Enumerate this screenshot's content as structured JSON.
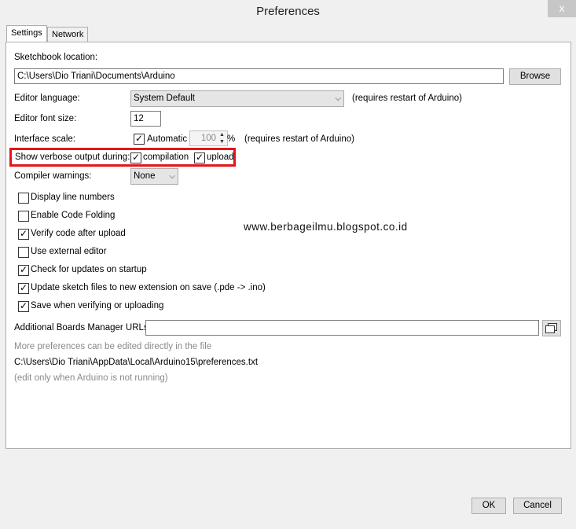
{
  "window": {
    "title": "Preferences",
    "close_glyph": "x"
  },
  "tabs": [
    {
      "label": "Settings"
    },
    {
      "label": "Network"
    }
  ],
  "sketchbook": {
    "label": "Sketchbook location:",
    "value": "C:\\Users\\Dio Triani\\Documents\\Arduino",
    "browse_label": "Browse"
  },
  "language": {
    "label": "Editor language:",
    "value": "System Default",
    "note": "(requires restart of Arduino)"
  },
  "font_size": {
    "label": "Editor font size:",
    "value": "12"
  },
  "scale": {
    "label": "Interface scale:",
    "automatic_label": "Automatic",
    "automatic_checked": true,
    "value": "100",
    "percent": "%",
    "note": "(requires restart of Arduino)"
  },
  "verbose": {
    "label": "Show verbose output during:",
    "compilation_label": "compilation",
    "compilation_checked": true,
    "upload_label": "upload",
    "upload_checked": true
  },
  "warnings": {
    "label": "Compiler warnings:",
    "value": "None"
  },
  "options": [
    {
      "label": "Display line numbers",
      "checked": false
    },
    {
      "label": "Enable Code Folding",
      "checked": false
    },
    {
      "label": "Verify code after upload",
      "checked": true
    },
    {
      "label": "Use external editor",
      "checked": false
    },
    {
      "label": "Check for updates on startup",
      "checked": true
    },
    {
      "label": "Update sketch files to new extension on save (.pde -> .ino)",
      "checked": true
    },
    {
      "label": "Save when verifying or uploading",
      "checked": true
    }
  ],
  "watermark": "www.berbageilmu.blogspot.co.id",
  "boards_urls": {
    "label": "Additional Boards Manager URLs:",
    "value": ""
  },
  "more_prefs": {
    "hint": "More preferences can be edited directly in the file",
    "path": "C:\\Users\\Dio Triani\\AppData\\Local\\Arduino15\\preferences.txt",
    "note": "(edit only when Arduino is not running)"
  },
  "footer": {
    "ok_label": "OK",
    "cancel_label": "Cancel"
  },
  "accent": {
    "highlight_border": "#e3151a"
  }
}
